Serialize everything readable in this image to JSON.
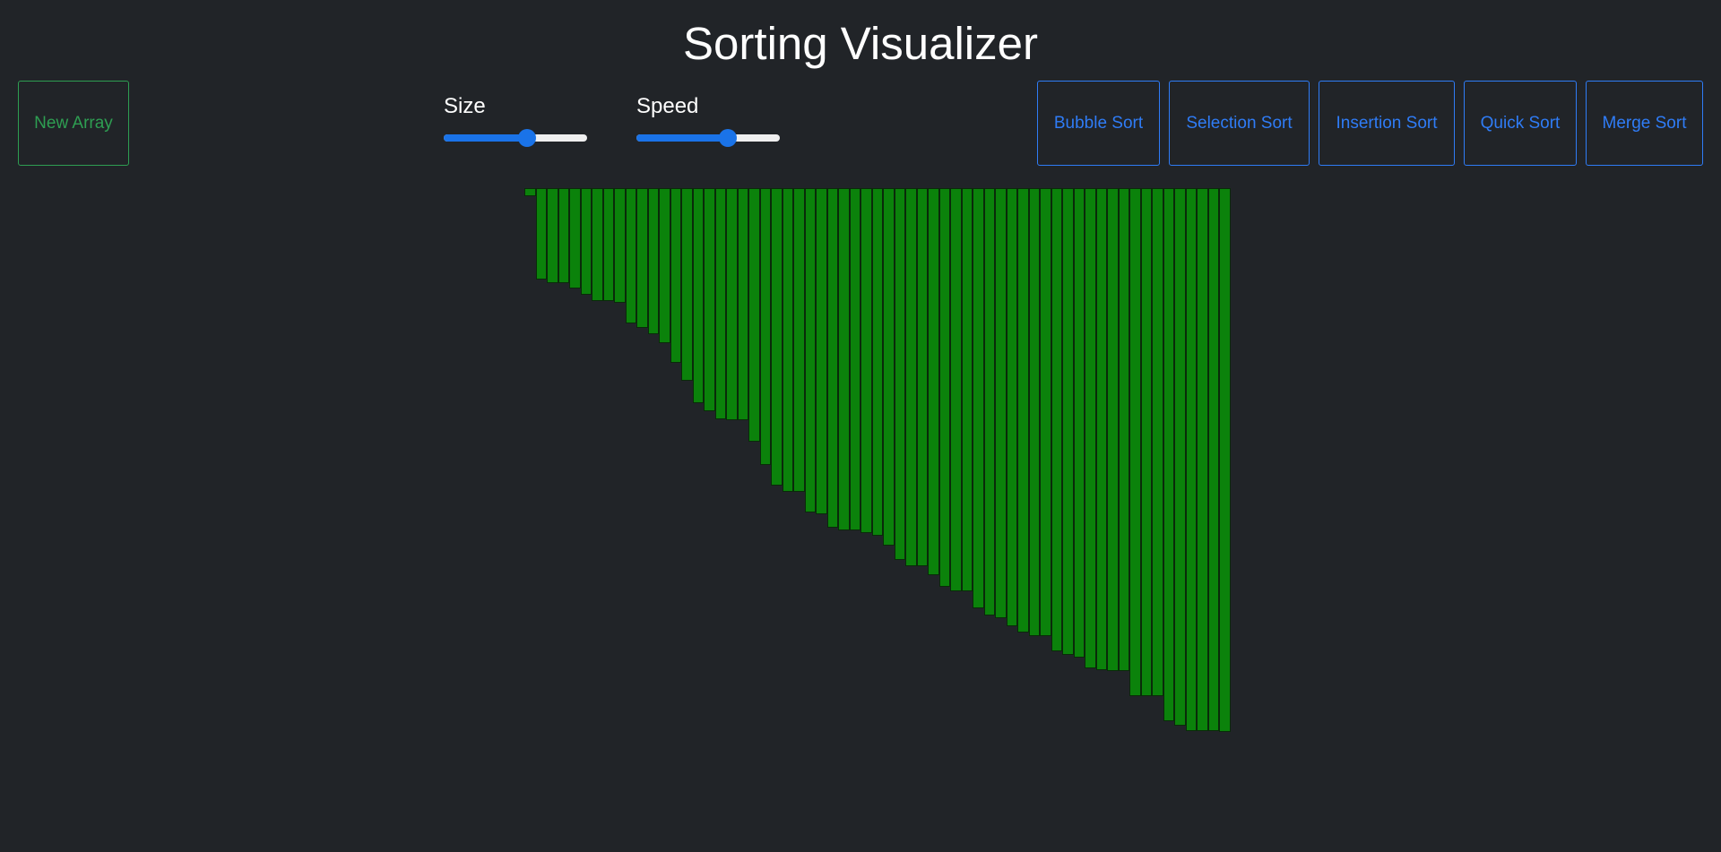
{
  "header": {
    "title": "Sorting Visualizer"
  },
  "controls": {
    "new_array_label": "New Array",
    "size_label": "Size",
    "speed_label": "Speed",
    "size_value": 0.58,
    "speed_value": 0.64
  },
  "algorithms": {
    "bubble": "Bubble Sort",
    "selection": "Selection Sort",
    "insertion": "Insertion Sort",
    "quick": "Quick Sort",
    "merge": "Merge Sort"
  },
  "colors": {
    "background": "#212428",
    "bar": "#0b820b",
    "primary": "#2f7cf6",
    "success": "#2e9e52"
  },
  "array": {
    "values": [
      9,
      102,
      106,
      106,
      112,
      119,
      126,
      126,
      128,
      151,
      156,
      163,
      173,
      195,
      215,
      240,
      249,
      258,
      259,
      259,
      283,
      309,
      332,
      339,
      339,
      362,
      364,
      379,
      382,
      382,
      385,
      388,
      399,
      415,
      422,
      422,
      432,
      445,
      450,
      450,
      469,
      477,
      480,
      489,
      496,
      500,
      500,
      517,
      521,
      524,
      536,
      538,
      539,
      539,
      567,
      567,
      567,
      595,
      600,
      606,
      606,
      606,
      607
    ],
    "max": 607
  }
}
